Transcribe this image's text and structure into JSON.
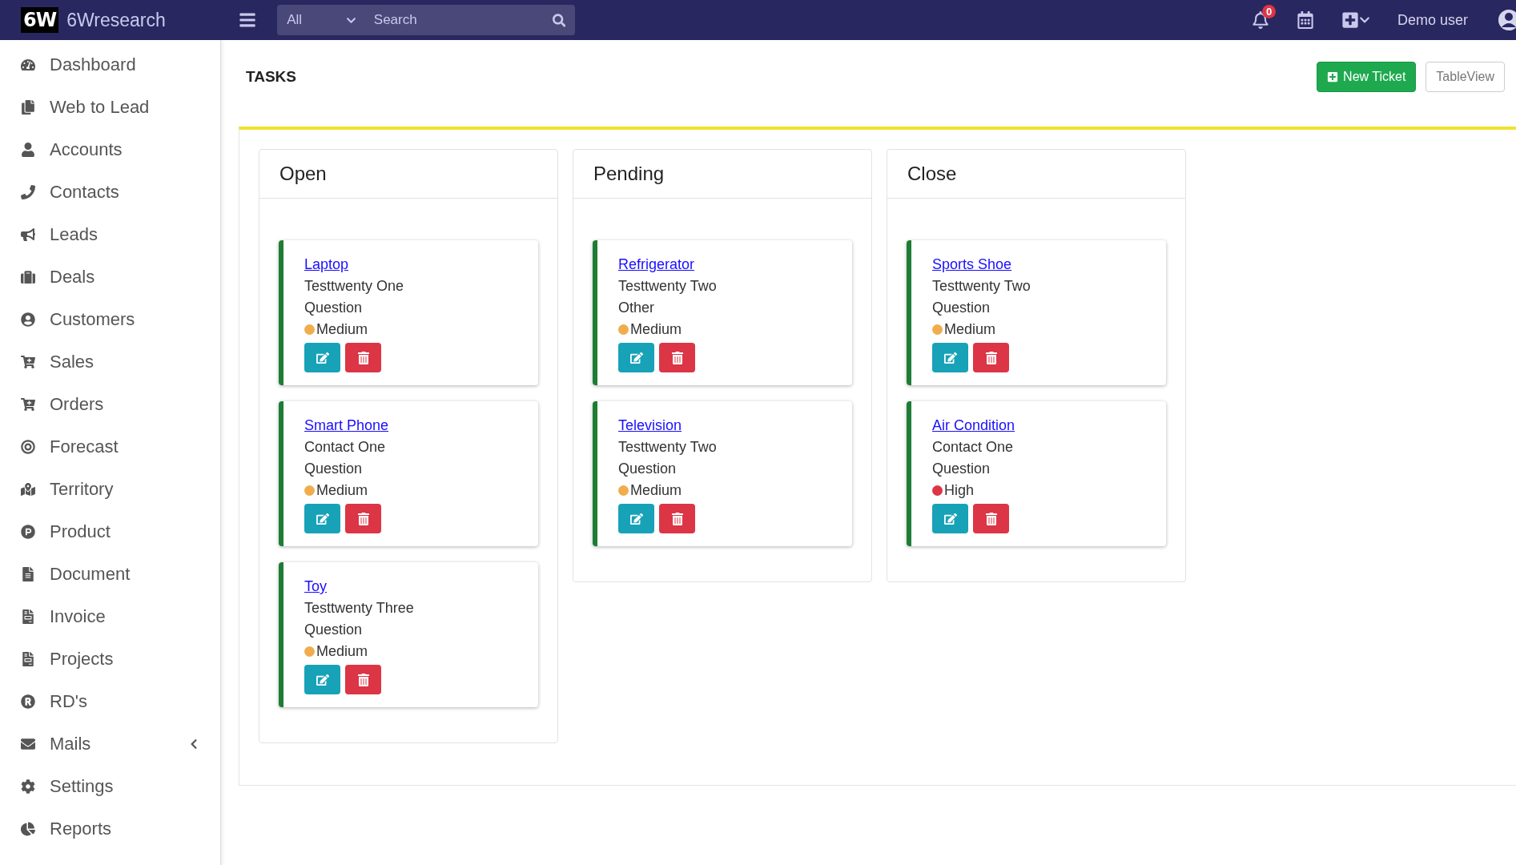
{
  "topbar": {
    "logo_mark": "6W",
    "brand": "6Wresearch",
    "search": {
      "scope": "All",
      "placeholder": "Search"
    },
    "notifications": "0",
    "user": "Demo user"
  },
  "sidebar": {
    "items": [
      {
        "label": "Dashboard",
        "kind": "link"
      },
      {
        "label": "Web to Lead",
        "kind": "link"
      },
      {
        "label": "Accounts",
        "kind": "link"
      },
      {
        "label": "Contacts",
        "kind": "link"
      },
      {
        "label": "Leads",
        "kind": "link"
      },
      {
        "label": "Deals",
        "kind": "link"
      },
      {
        "label": "Customers",
        "kind": "link"
      },
      {
        "label": "Sales",
        "kind": "link"
      },
      {
        "label": "Orders",
        "kind": "link"
      },
      {
        "label": "Forecast",
        "kind": "link"
      },
      {
        "label": "Territory",
        "kind": "link"
      },
      {
        "label": "Product",
        "kind": "link"
      },
      {
        "label": "Document",
        "kind": "link"
      },
      {
        "label": "Invoice",
        "kind": "link"
      },
      {
        "label": "Projects",
        "kind": "link"
      },
      {
        "label": "RD's",
        "kind": "link"
      },
      {
        "label": "Mails",
        "kind": "group",
        "expanded": false
      },
      {
        "label": "Settings",
        "kind": "link"
      },
      {
        "label": "Reports",
        "kind": "link"
      }
    ]
  },
  "page": {
    "title": "TASKS",
    "buttons": [
      {
        "label": "New Ticket",
        "kind": "primary"
      },
      {
        "label": "TableView",
        "kind": "outline"
      }
    ]
  },
  "board": {
    "columns": [
      {
        "title": "Open",
        "cards": [
          {
            "title": "Laptop",
            "contact": "Testtwenty One",
            "type": "Question",
            "priority": "Medium",
            "color": "#f0ad4e"
          },
          {
            "title": "Smart Phone",
            "contact": "Contact One",
            "type": "Question",
            "priority": "Medium",
            "color": "#f0ad4e"
          },
          {
            "title": "Toy",
            "contact": "Testtwenty Three",
            "type": "Question",
            "priority": "Medium",
            "color": "#f0ad4e"
          }
        ]
      },
      {
        "title": "Pending",
        "cards": [
          {
            "title": "Refrigerator",
            "contact": "Testtwenty Two",
            "type": "Other",
            "priority": "Medium",
            "color": "#f0ad4e"
          },
          {
            "title": "Television",
            "contact": "Testtwenty Two",
            "type": "Question",
            "priority": "Medium",
            "color": "#f0ad4e"
          }
        ]
      },
      {
        "title": "Close",
        "cards": [
          {
            "title": "Sports Shoe",
            "contact": "Testtwenty Two",
            "type": "Question",
            "priority": "Medium",
            "color": "#f0ad4e"
          },
          {
            "title": "Air Condition",
            "contact": "Contact One",
            "type": "Question",
            "priority": "High",
            "color": "#dc3545"
          }
        ]
      }
    ]
  }
}
